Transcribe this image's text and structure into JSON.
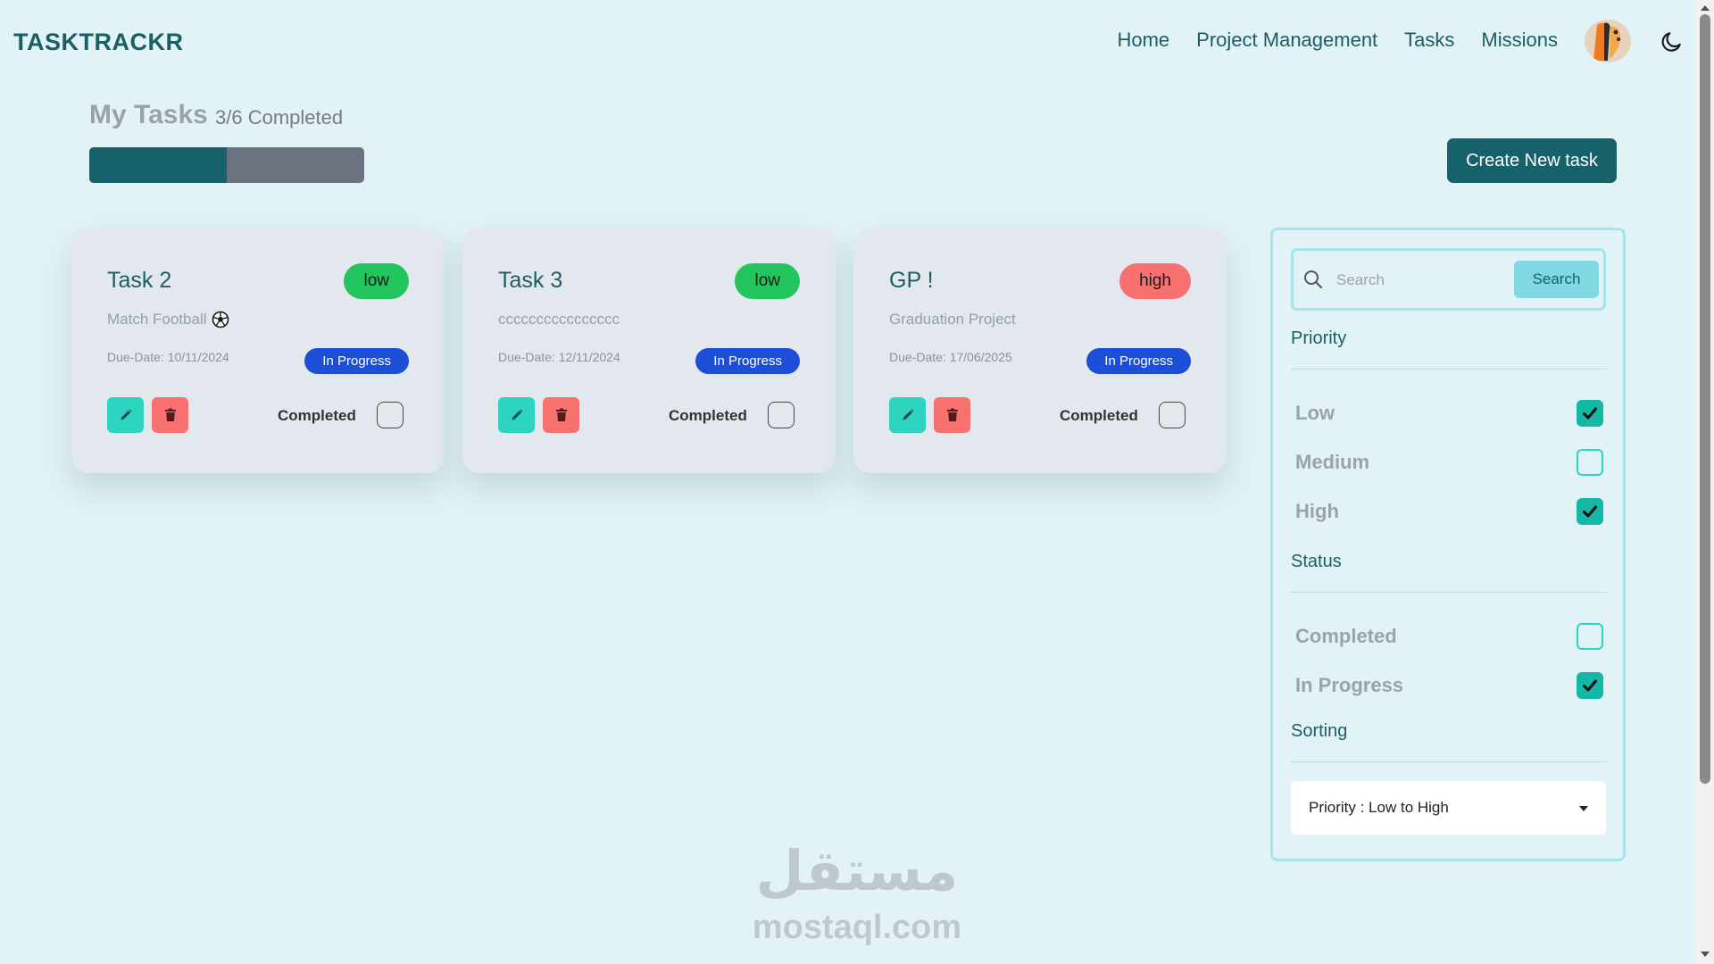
{
  "navbar": {
    "brand": "TASKTRACKR",
    "links": [
      "Home",
      "Project Management",
      "Tasks",
      "Missions"
    ],
    "avatar_icon": "avatar-illustration",
    "theme_icon": "moon-icon"
  },
  "header": {
    "title": "My Tasks",
    "completed_text": "3/6 Completed",
    "progress_fraction": 0.5,
    "create_button": "Create New task"
  },
  "cards": [
    {
      "title": "Task 2",
      "priority": "low",
      "description": "Match Football",
      "description_icon": "soccer-ball-icon",
      "due": "Due-Date: 10/11/2024",
      "status": "In Progress",
      "completed_label": "Completed",
      "completed": false
    },
    {
      "title": "Task 3",
      "priority": "low",
      "description": "cccccccccccccccc",
      "due": "Due-Date: 12/11/2024",
      "status": "In Progress",
      "completed_label": "Completed",
      "completed": false
    },
    {
      "title": "GP !",
      "priority": "high",
      "description": "Graduation Project",
      "due": "Due-Date: 17/06/2025",
      "status": "In Progress",
      "completed_label": "Completed",
      "completed": false
    }
  ],
  "filters": {
    "search_placeholder": "Search",
    "search_button": "Search",
    "priority_title": "Priority",
    "priority": [
      {
        "label": "Low",
        "checked": true
      },
      {
        "label": "Medium",
        "checked": false
      },
      {
        "label": "High",
        "checked": true
      }
    ],
    "status_title": "Status",
    "status": [
      {
        "label": "Completed",
        "checked": false
      },
      {
        "label": "In Progress",
        "checked": true
      }
    ],
    "sorting_title": "Sorting",
    "sorting_value": "Priority : Low to High"
  },
  "watermark": {
    "logo": "مستقل",
    "url": "mostaql.com"
  },
  "colors": {
    "primary": "#17626a",
    "background": "#e1f3f7",
    "low": "#22c55e",
    "high": "#f87171",
    "status": "#1d4ed8",
    "accent": "#2dd4bf"
  }
}
